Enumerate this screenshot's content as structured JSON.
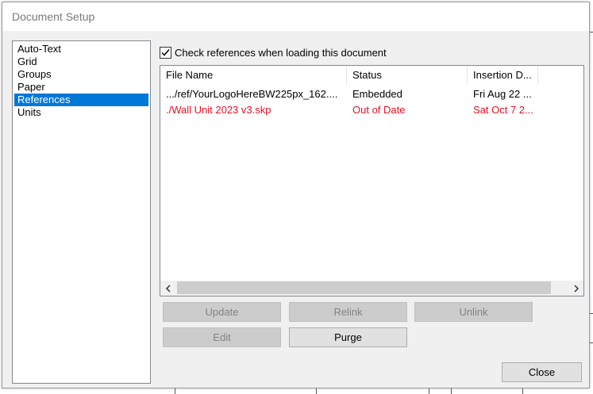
{
  "dialog": {
    "title": "Document Setup"
  },
  "categories": [
    {
      "label": "Auto-Text",
      "selected": false
    },
    {
      "label": "Grid",
      "selected": false
    },
    {
      "label": "Groups",
      "selected": false
    },
    {
      "label": "Paper",
      "selected": false
    },
    {
      "label": "References",
      "selected": true
    },
    {
      "label": "Units",
      "selected": false
    }
  ],
  "references": {
    "check_label": "Check references when loading this document",
    "checked": true,
    "columns": [
      "File Name",
      "Status",
      "Insertion D..."
    ],
    "rows": [
      {
        "file": ".../ref/YourLogoHereBW225px_162....",
        "status": "Embedded",
        "date": "Fri Aug 22 ...",
        "state": "ok"
      },
      {
        "file": "./Wall Unit 2023 v3.skp",
        "status": "Out of Date",
        "date": "Sat Oct  7 2...",
        "state": "out-of-date"
      }
    ],
    "scroll_left_icon": "chevron-left-icon",
    "scroll_right_icon": "chevron-right-icon"
  },
  "buttons": {
    "update": "Update",
    "relink": "Relink",
    "unlink": "Unlink",
    "edit": "Edit",
    "purge": "Purge",
    "close": "Close"
  },
  "colors": {
    "selection": "#0078d7",
    "out_of_date": "#e81123",
    "disabled_text": "#838383"
  }
}
